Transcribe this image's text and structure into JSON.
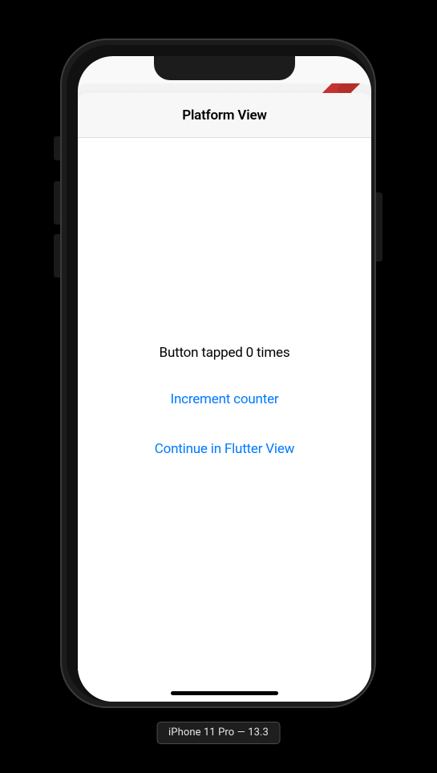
{
  "nav": {
    "title": "Platform View"
  },
  "body": {
    "counter_text": "Button tapped 0 times",
    "increment_label": "Increment counter",
    "continue_label": "Continue in Flutter View"
  },
  "device_label": "iPhone 11 Pro — 13.3"
}
